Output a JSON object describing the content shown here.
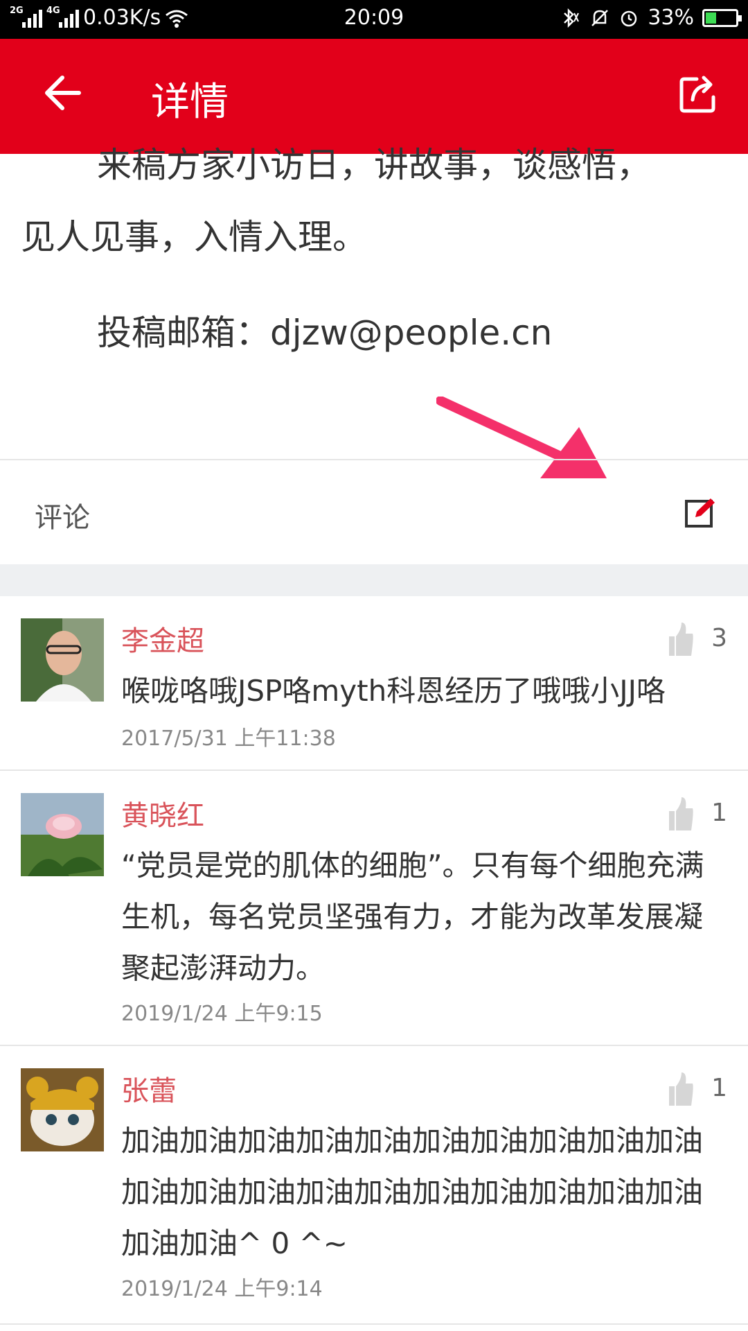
{
  "status_bar": {
    "net_left": "2G",
    "net_right": "4G",
    "speed": "0.03K/s",
    "time": "20:09",
    "battery": "33%",
    "battery_level": 0.33
  },
  "appbar": {
    "title": "详情"
  },
  "article": {
    "cut_line": "来稿方家小访日，讲故事，谈感悟，",
    "line2": "见人见事，入情入理。",
    "email": "投稿邮箱：djzw@people.cn"
  },
  "comments_header": {
    "label": "评论"
  },
  "comments": [
    {
      "name": "李金超",
      "likes": "3",
      "text": "喉咙咯哦JSP咯myth科恩经历了哦哦小JJ咯",
      "time": "2017/5/31 上午11:38"
    },
    {
      "name": "黄晓红",
      "likes": "1",
      "text": "“党员是党的肌体的细胞”。只有每个细胞充满生机，每名党员坚强有力，才能为改革发展凝聚起澎湃动力。",
      "time": "2019/1/24 上午9:15"
    },
    {
      "name": "张蕾",
      "likes": "1",
      "text": "加油加油加油加油加油加油加油加油加油加油加油加油加油加油加油加油加油加油加油加油加油加油^ 0 ^~",
      "time": "2019/1/24 上午9:14"
    }
  ],
  "colors": {
    "appbar": "#e2001a",
    "name": "#d9535a",
    "arrow": "#f4306a"
  }
}
